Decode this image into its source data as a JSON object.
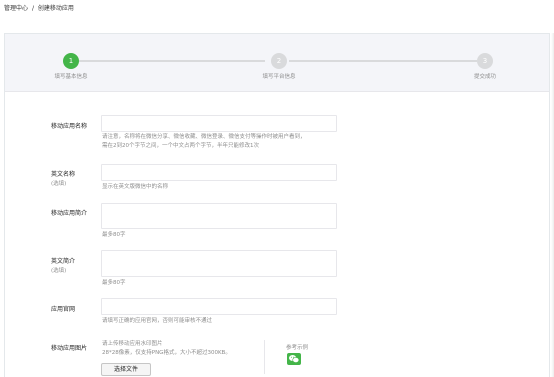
{
  "breadcrumb": {
    "home": "管理中心",
    "separator": "/",
    "current": "创建移动应用"
  },
  "steps": [
    {
      "number": "1",
      "label": "填写基本信息",
      "active": true
    },
    {
      "number": "2",
      "label": "填写平台信息",
      "active": false
    },
    {
      "number": "3",
      "label": "提交成功",
      "active": false
    }
  ],
  "form": {
    "app_name": {
      "label": "移动应用名称",
      "value": "",
      "hint_line1": "请注意，名称将在微信分享、微信收藏、微信登录、微信支付等操作时被用户看到，",
      "hint_line2": "需在2到20个字节之间，一个中文占两个字节，半年只能修改1次"
    },
    "english_name": {
      "label": "英文名称",
      "optional": "(选填)",
      "value": "",
      "hint": "显示在英文版微信中的名称"
    },
    "app_intro": {
      "label": "移动应用简介",
      "value": "",
      "hint": "最多80字"
    },
    "english_intro": {
      "label": "英文简介",
      "optional": "(选填)",
      "value": "",
      "hint": "最多80字"
    },
    "website": {
      "label": "应用官网",
      "value": "",
      "hint": "请填写正确的应用官网，否则可能审核不通过"
    },
    "app_image": {
      "label": "移动应用图片",
      "hint_line1": "请上传移动应用水印图片",
      "hint_line2": "28*28像素，仅支持PNG格式，大小不超过300KB。",
      "upload_label": "选择文件",
      "example_label": "参考示例",
      "example_icon": "wechat-icon"
    }
  },
  "colors": {
    "accent": "#44b549",
    "inactive": "#d9dadc",
    "hint": "#8d8d8d"
  }
}
